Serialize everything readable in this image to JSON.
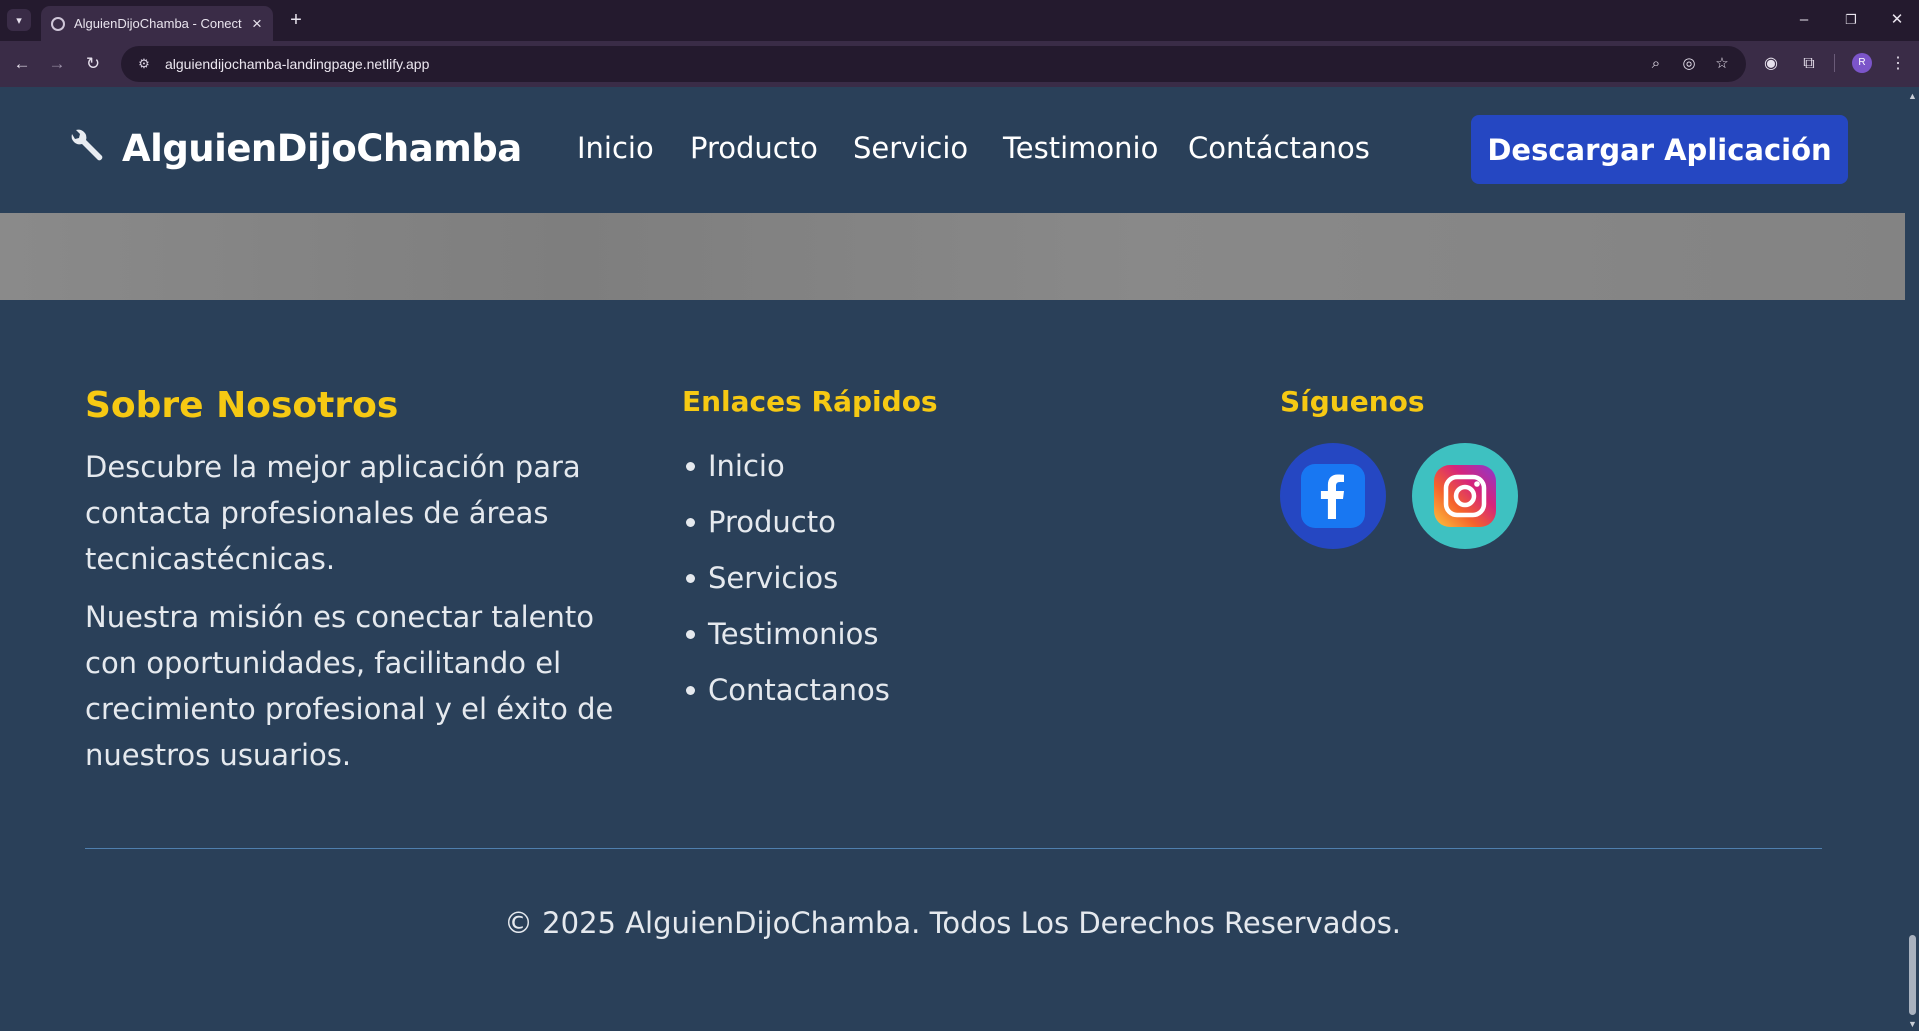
{
  "browser": {
    "tab_title": "AlguienDijoChamba - Conectan",
    "url": "alguiendijochamba-landingpage.netlify.app",
    "profile_initial": "R"
  },
  "header": {
    "logo_text": "AlguienDijoChamba",
    "nav": [
      "Inicio",
      "Producto",
      "Servicio",
      "Testimonio",
      "Contáctanos"
    ],
    "cta_label": "Descargar Aplicación"
  },
  "footer": {
    "about": {
      "title": "Sobre Nosotros",
      "paragraphs": [
        "Descubre la mejor aplicación para contacta profesionales de áreas tecnicastécnicas.",
        "Nuestra misión es conectar talento con oportunidades, facilitando el crecimiento profesional y el éxito de nuestros usuarios."
      ]
    },
    "links": {
      "title": "Enlaces Rápidos",
      "items": [
        "Inicio",
        "Producto",
        "Servicios",
        "Testimonios",
        "Contactanos"
      ]
    },
    "social": {
      "title": "Síguenos",
      "icons": [
        "facebook-icon",
        "instagram-icon"
      ]
    },
    "copyright": "© 2025 AlguienDijoChamba. Todos Los Derechos Reservados."
  },
  "colors": {
    "page_bg": "#2a4059",
    "accent_yellow": "#f6c913",
    "cta_blue": "#2547c2",
    "instagram_bg": "#3ec1c1"
  }
}
